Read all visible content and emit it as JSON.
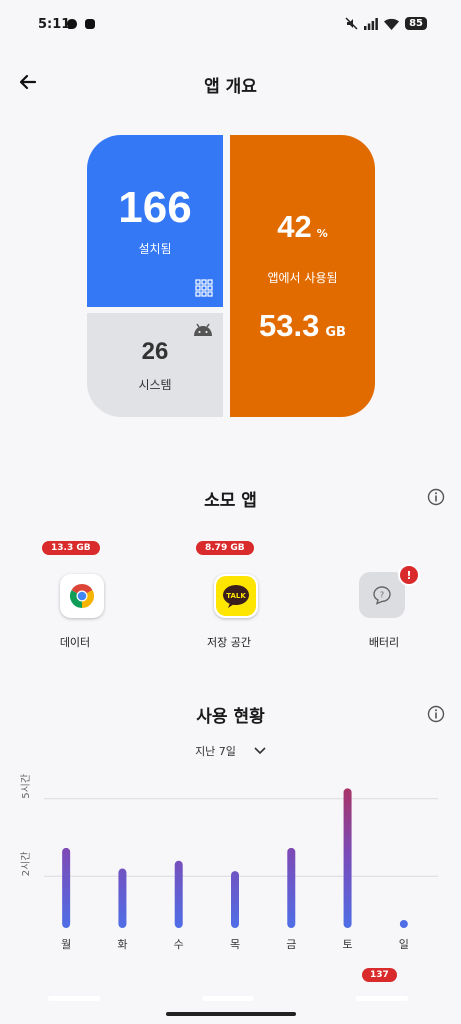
{
  "status": {
    "time": "5:11",
    "battery": "85"
  },
  "header": {
    "title": "앱 개요"
  },
  "summary": {
    "installed_count": "166",
    "installed_label": "설치됨",
    "system_count": "26",
    "system_label": "시스템",
    "used_percent": "42",
    "percent_unit": "%",
    "used_label": "앱에서 사용됨",
    "used_size": "53.3",
    "size_unit": "GB",
    "colors": {
      "installed": "#3478f6",
      "system": "#e1e2e6",
      "used": "#e26b00"
    }
  },
  "consuming": {
    "title": "소모 앱",
    "groups": [
      {
        "label": "데이터",
        "badge": "13.3 GB"
      },
      {
        "label": "저장 공간",
        "badge": "8.79 GB"
      },
      {
        "label": "배터리",
        "alert": "!"
      }
    ]
  },
  "usage": {
    "title": "사용 현황",
    "period": "지난 7일",
    "peek_badge": "137"
  },
  "chart_data": {
    "type": "bar",
    "categories": [
      "월",
      "화",
      "수",
      "목",
      "금",
      "토",
      "일"
    ],
    "values": [
      3.1,
      2.3,
      2.6,
      2.2,
      3.1,
      5.4,
      0.1
    ],
    "y_ticks": [
      {
        "value": 2,
        "label": "2시간"
      },
      {
        "value": 5,
        "label": "5시간"
      }
    ],
    "unit": "hours",
    "ylim": [
      0,
      5.8
    ],
    "grid": true,
    "colors": {
      "low": "#4f6ee6",
      "high": "#b0305a",
      "mid": "#7b4bb8"
    }
  }
}
